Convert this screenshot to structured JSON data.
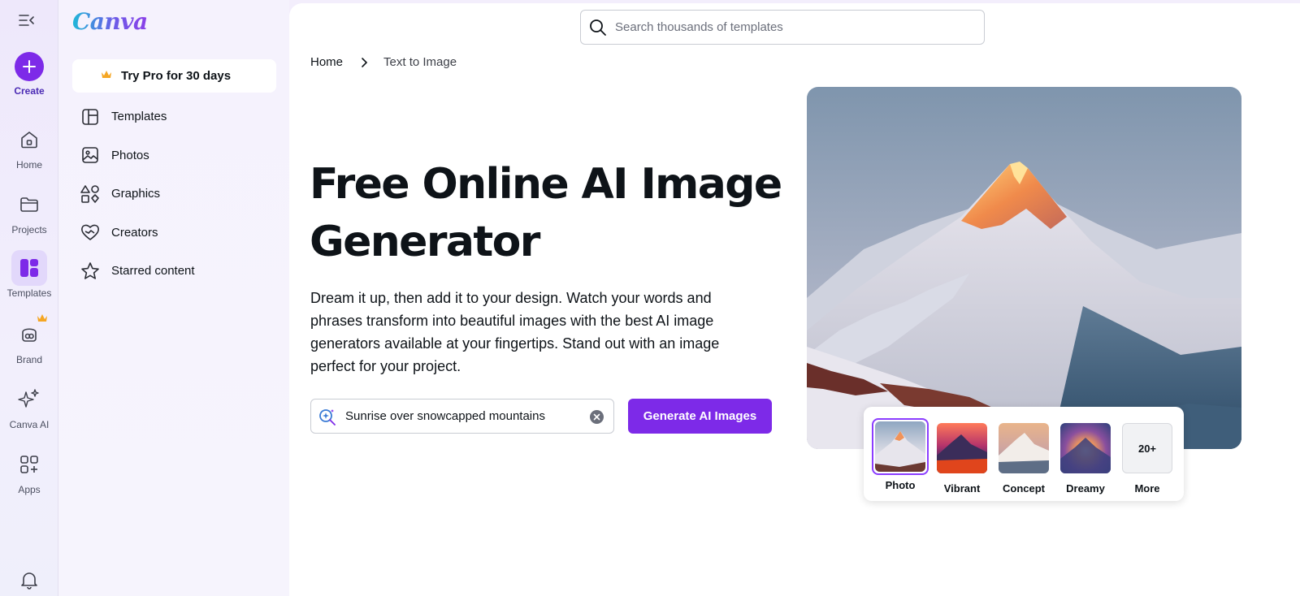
{
  "app": {
    "logo_text": "Canva",
    "accent": "#7d2ae8"
  },
  "rail": {
    "collapse_icon": "sidebar-collapse-icon",
    "create_label": "Create",
    "items": [
      {
        "label": "Home",
        "icon": "home-icon"
      },
      {
        "label": "Projects",
        "icon": "folder-icon"
      },
      {
        "label": "Templates",
        "icon": "templates-icon",
        "active": true
      },
      {
        "label": "Brand",
        "icon": "brand-icon",
        "pro": true
      },
      {
        "label": "Canva AI",
        "icon": "sparkles-icon"
      },
      {
        "label": "Apps",
        "icon": "apps-icon"
      }
    ],
    "bell_icon": "bell-icon"
  },
  "sidebar": {
    "try_pro": "Try Pro for 30 days",
    "items": [
      {
        "label": "Templates",
        "icon": "templates-outline-icon"
      },
      {
        "label": "Photos",
        "icon": "photo-icon"
      },
      {
        "label": "Graphics",
        "icon": "shapes-icon"
      },
      {
        "label": "Creators",
        "icon": "heart-icon"
      },
      {
        "label": "Starred content",
        "icon": "star-icon"
      }
    ]
  },
  "search": {
    "placeholder": "Search thousands of templates"
  },
  "breadcrumb": {
    "home": "Home",
    "current": "Text to Image"
  },
  "hero": {
    "title_line1": "Free Online AI Image",
    "title_line2": "Generator",
    "description": "Dream it up, then add it to your design. Watch your words and phrases transform into beautiful images with the best AI image generators available at your fingertips. Stand out with an image perfect for your project.",
    "prompt_value": "Sunrise over snowcapped mountains",
    "generate_label": "Generate AI Images"
  },
  "styles": {
    "options": [
      {
        "label": "Photo",
        "selected": true
      },
      {
        "label": "Vibrant"
      },
      {
        "label": "Concept"
      },
      {
        "label": "Dreamy"
      },
      {
        "label": "More",
        "badge": "20+"
      }
    ]
  }
}
